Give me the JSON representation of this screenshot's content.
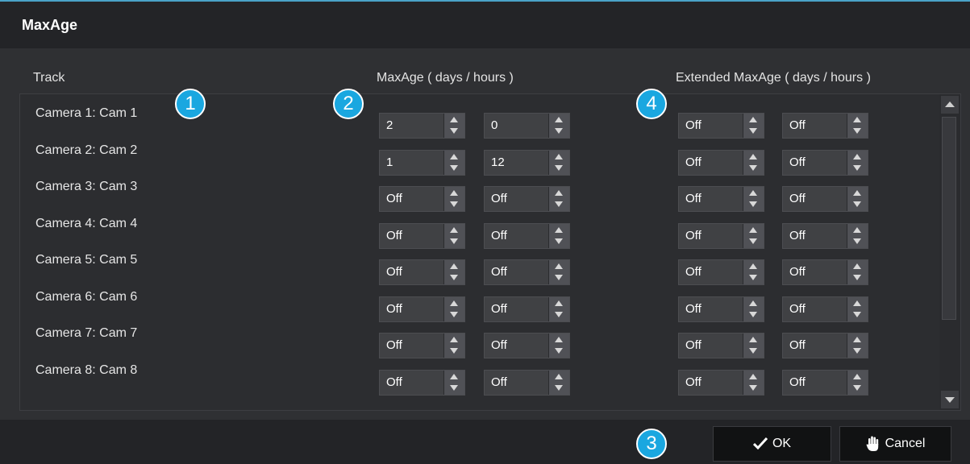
{
  "dialog": {
    "title": "MaxAge"
  },
  "headers": {
    "track": "Track",
    "maxage": "MaxAge ( days / hours )",
    "extended": "Extended MaxAge ( days / hours )"
  },
  "rows": [
    {
      "label": "Camera 1: Cam 1",
      "maxage_days": "2",
      "maxage_hours": "0",
      "ext_days": "Off",
      "ext_hours": "Off"
    },
    {
      "label": "Camera 2: Cam 2",
      "maxage_days": "1",
      "maxage_hours": "12",
      "ext_days": "Off",
      "ext_hours": "Off"
    },
    {
      "label": "Camera 3: Cam 3",
      "maxage_days": "Off",
      "maxage_hours": "Off",
      "ext_days": "Off",
      "ext_hours": "Off"
    },
    {
      "label": "Camera 4: Cam 4",
      "maxage_days": "Off",
      "maxage_hours": "Off",
      "ext_days": "Off",
      "ext_hours": "Off"
    },
    {
      "label": "Camera 5: Cam 5",
      "maxage_days": "Off",
      "maxage_hours": "Off",
      "ext_days": "Off",
      "ext_hours": "Off"
    },
    {
      "label": "Camera 6: Cam 6",
      "maxage_days": "Off",
      "maxage_hours": "Off",
      "ext_days": "Off",
      "ext_hours": "Off"
    },
    {
      "label": "Camera 7: Cam 7",
      "maxage_days": "Off",
      "maxage_hours": "Off",
      "ext_days": "Off",
      "ext_hours": "Off"
    },
    {
      "label": "Camera 8: Cam 8",
      "maxage_days": "Off",
      "maxage_hours": "Off",
      "ext_days": "Off",
      "ext_hours": "Off"
    }
  ],
  "buttons": {
    "ok": "OK",
    "cancel": "Cancel"
  },
  "icons": {
    "ok": "checkmark-icon",
    "cancel": "hand-stop-icon"
  },
  "badges": [
    "1",
    "2",
    "3",
    "4"
  ],
  "colors": {
    "accent": "#1aa7e0",
    "title_bar": "#232427",
    "background": "#2f3033"
  }
}
